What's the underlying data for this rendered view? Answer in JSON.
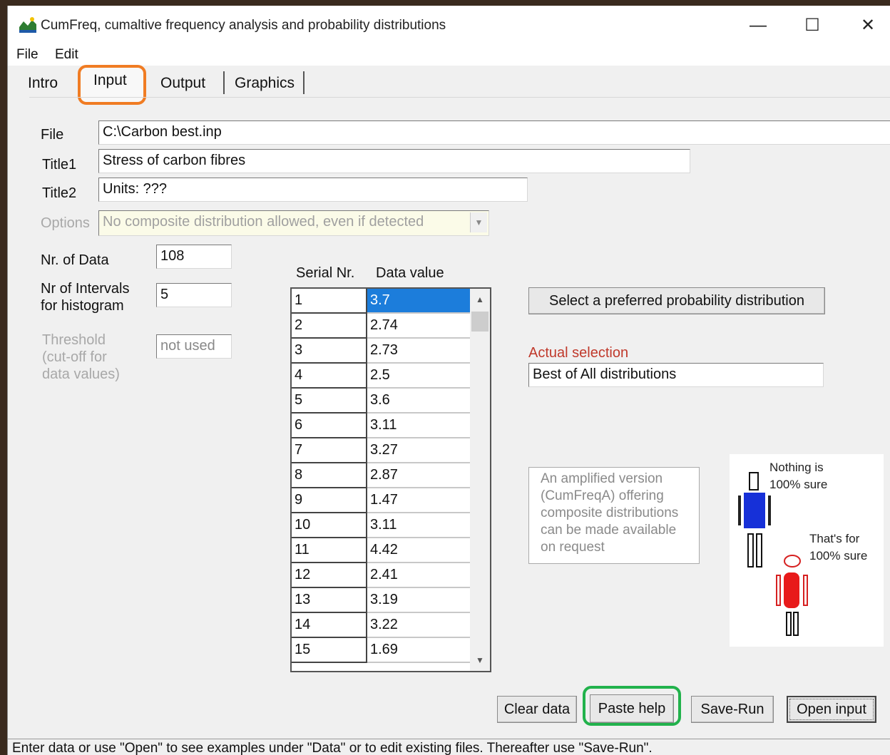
{
  "window": {
    "title": "CumFreq, cumaltive frequency analysis and probability distributions",
    "minimize": "—",
    "maximize": "☐",
    "close": "✕"
  },
  "menu": {
    "file": "File",
    "edit": "Edit"
  },
  "tabs": [
    {
      "label": "Intro"
    },
    {
      "label": "Input"
    },
    {
      "label": "Output"
    },
    {
      "label": "Graphics"
    }
  ],
  "form": {
    "file_label": "File",
    "file_value": "C:\\Carbon best.inp",
    "title1_label": "Title1",
    "title1_value": "Stress of carbon fibres",
    "title2_label": "Title2",
    "title2_value": "Units: ???",
    "options_label": "Options",
    "options_value": "No composite distribution allowed, even if detected",
    "nr_data_label": "Nr. of Data",
    "nr_data_value": "108",
    "intervals_label_1": "Nr of Intervals",
    "intervals_label_2": "for histogram",
    "intervals_value": "5",
    "threshold_label_1": "Threshold",
    "threshold_label_2": "(cut-off for",
    "threshold_label_3": "data values)",
    "threshold_value": "not used"
  },
  "grid": {
    "header_serial": "Serial Nr.",
    "header_value": "Data value",
    "rows": [
      {
        "serial": "1",
        "value": "3.7"
      },
      {
        "serial": "2",
        "value": "2.74"
      },
      {
        "serial": "3",
        "value": "2.73"
      },
      {
        "serial": "4",
        "value": "2.5"
      },
      {
        "serial": "5",
        "value": "3.6"
      },
      {
        "serial": "6",
        "value": "3.11"
      },
      {
        "serial": "7",
        "value": "3.27"
      },
      {
        "serial": "8",
        "value": "2.87"
      },
      {
        "serial": "9",
        "value": "1.47"
      },
      {
        "serial": "10",
        "value": "3.11"
      },
      {
        "serial": "11",
        "value": "4.42"
      },
      {
        "serial": "12",
        "value": "2.41"
      },
      {
        "serial": "13",
        "value": "3.19"
      },
      {
        "serial": "14",
        "value": "3.22"
      },
      {
        "serial": "15",
        "value": "1.69"
      }
    ]
  },
  "right": {
    "select_button": "Select a preferred probability distribution",
    "actual_label": "Actual selection",
    "actual_value": "Best of All distributions",
    "note_lines": [
      "An amplified version",
      "(CumFreqA) offering",
      "composite  distributions",
      "can be  made available",
      "on request"
    ],
    "caption1_line1": "Nothing is",
    "caption1_line2": "100% sure",
    "caption2_line1": "That's for",
    "caption2_line2": "100% sure"
  },
  "buttons": {
    "clear": "Clear data",
    "paste_help": "Paste help",
    "save_run": "Save-Run",
    "open_input": "Open input"
  },
  "status": "Enter data or use \"Open\" to see examples under \"Data\" or to edit existing files. Thereafter use \"Save-Run\".",
  "colors": {
    "selected_cell": "#1c7ddb",
    "actual_label": "#c0392b",
    "input_tab_highlight": "#f07c23",
    "paste_highlight": "#22b24c"
  }
}
